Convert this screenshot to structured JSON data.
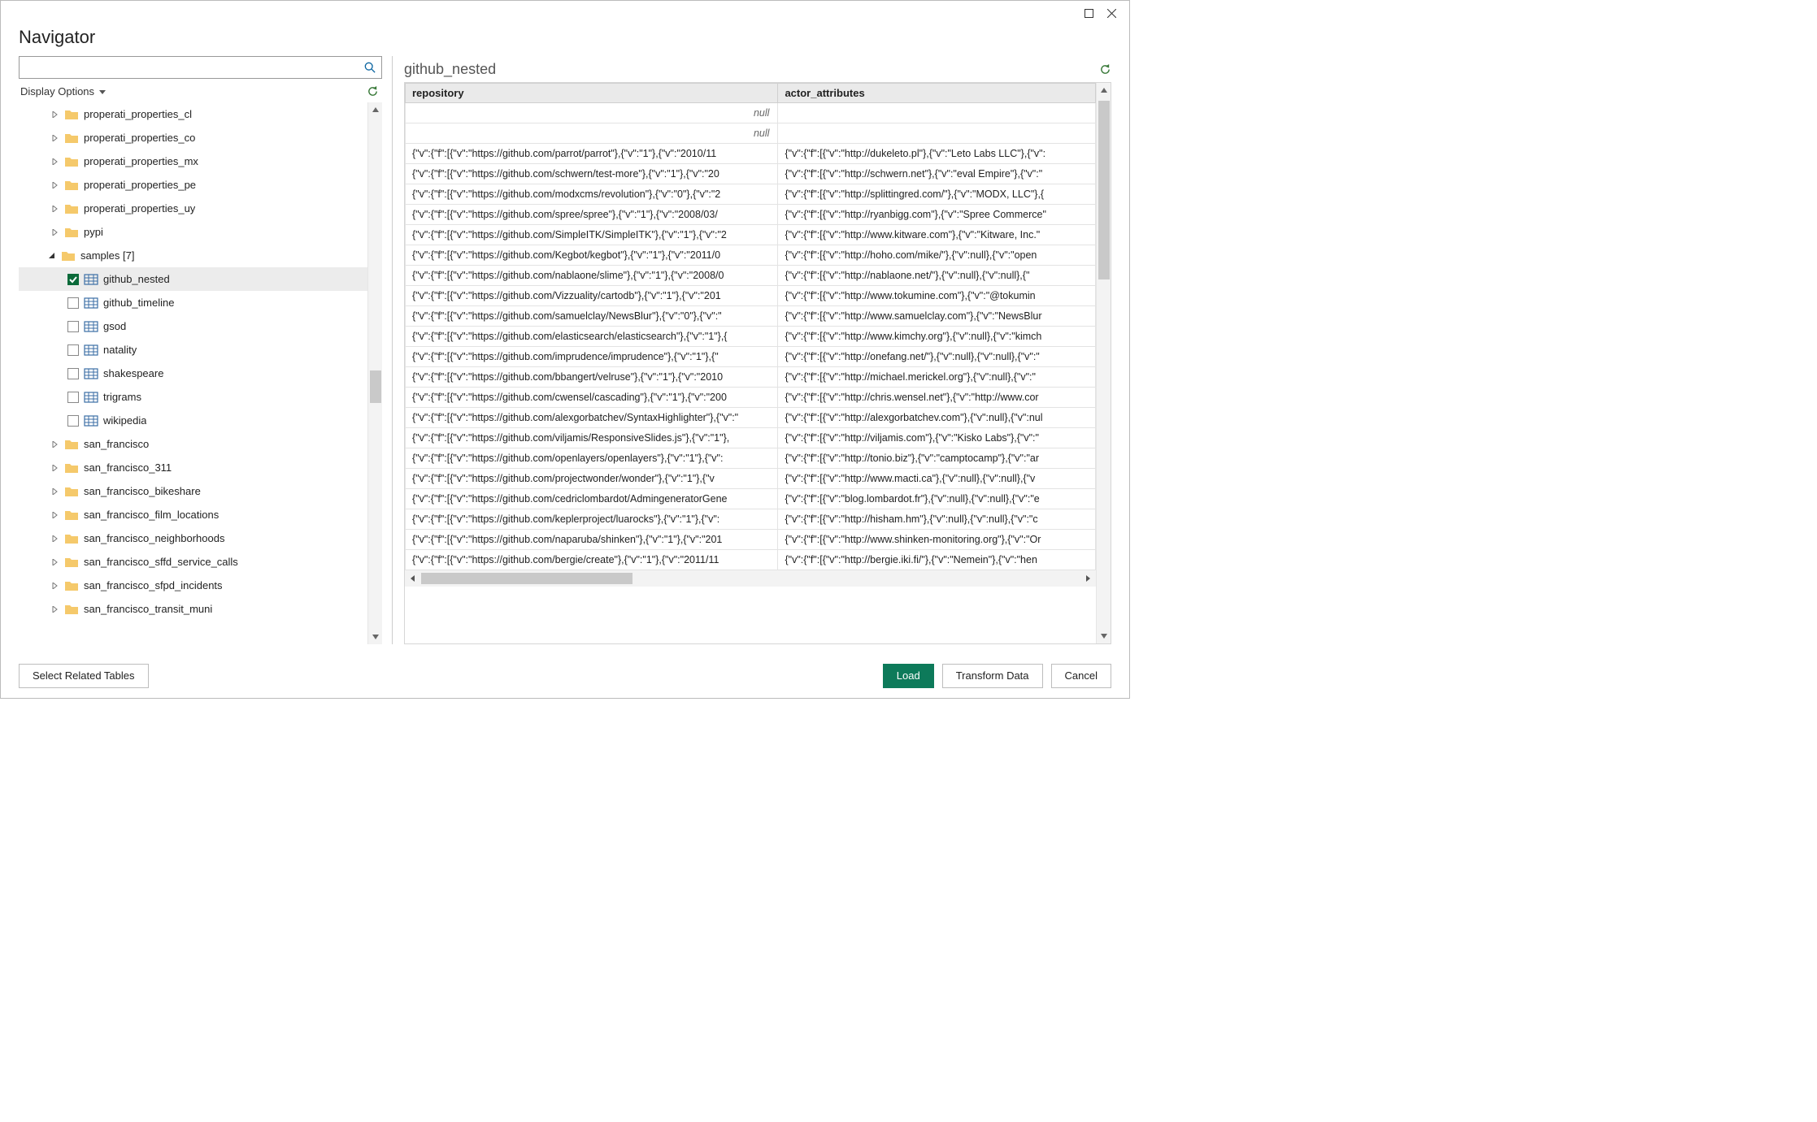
{
  "window_title": "Navigator",
  "search_placeholder": "",
  "display_options_label": "Display Options",
  "select_related_label": "Select Related Tables",
  "preview_title": "github_nested",
  "null_text": "null",
  "buttons": {
    "load": "Load",
    "transform": "Transform Data",
    "cancel": "Cancel"
  },
  "columns": [
    "repository",
    "actor_attributes"
  ],
  "tree_folders_top": [
    "properati_properties_cl",
    "properati_properties_co",
    "properati_properties_mx",
    "properati_properties_pe",
    "properati_properties_uy",
    "pypi"
  ],
  "samples_label": "samples [7]",
  "samples_children": [
    {
      "label": "github_nested",
      "checked": true
    },
    {
      "label": "github_timeline",
      "checked": false
    },
    {
      "label": "gsod",
      "checked": false
    },
    {
      "label": "natality",
      "checked": false
    },
    {
      "label": "shakespeare",
      "checked": false
    },
    {
      "label": "trigrams",
      "checked": false
    },
    {
      "label": "wikipedia",
      "checked": false
    }
  ],
  "tree_folders_bottom": [
    "san_francisco",
    "san_francisco_311",
    "san_francisco_bikeshare",
    "san_francisco_film_locations",
    "san_francisco_neighborhoods",
    "san_francisco_sffd_service_calls",
    "san_francisco_sfpd_incidents",
    "san_francisco_transit_muni"
  ],
  "rows": [
    {
      "repository": null,
      "actor_attributes": ""
    },
    {
      "repository": null,
      "actor_attributes": ""
    },
    {
      "repository": "{\"v\":{\"f\":[{\"v\":\"https://github.com/parrot/parrot\"},{\"v\":\"1\"},{\"v\":\"2010/11",
      "actor_attributes": "{\"v\":{\"f\":[{\"v\":\"http://dukeleto.pl\"},{\"v\":\"Leto Labs LLC\"},{\"v\":"
    },
    {
      "repository": "{\"v\":{\"f\":[{\"v\":\"https://github.com/schwern/test-more\"},{\"v\":\"1\"},{\"v\":\"20",
      "actor_attributes": "{\"v\":{\"f\":[{\"v\":\"http://schwern.net\"},{\"v\":\"eval Empire\"},{\"v\":\""
    },
    {
      "repository": "{\"v\":{\"f\":[{\"v\":\"https://github.com/modxcms/revolution\"},{\"v\":\"0\"},{\"v\":\"2",
      "actor_attributes": "{\"v\":{\"f\":[{\"v\":\"http://splittingred.com/\"},{\"v\":\"MODX, LLC\"},{"
    },
    {
      "repository": "{\"v\":{\"f\":[{\"v\":\"https://github.com/spree/spree\"},{\"v\":\"1\"},{\"v\":\"2008/03/",
      "actor_attributes": "{\"v\":{\"f\":[{\"v\":\"http://ryanbigg.com\"},{\"v\":\"Spree Commerce\""
    },
    {
      "repository": "{\"v\":{\"f\":[{\"v\":\"https://github.com/SimpleITK/SimpleITK\"},{\"v\":\"1\"},{\"v\":\"2",
      "actor_attributes": "{\"v\":{\"f\":[{\"v\":\"http://www.kitware.com\"},{\"v\":\"Kitware, Inc.\""
    },
    {
      "repository": "{\"v\":{\"f\":[{\"v\":\"https://github.com/Kegbot/kegbot\"},{\"v\":\"1\"},{\"v\":\"2011/0",
      "actor_attributes": "{\"v\":{\"f\":[{\"v\":\"http://hoho.com/mike/\"},{\"v\":null},{\"v\":\"open"
    },
    {
      "repository": "{\"v\":{\"f\":[{\"v\":\"https://github.com/nablaone/slime\"},{\"v\":\"1\"},{\"v\":\"2008/0",
      "actor_attributes": "{\"v\":{\"f\":[{\"v\":\"http://nablaone.net/\"},{\"v\":null},{\"v\":null},{\""
    },
    {
      "repository": "{\"v\":{\"f\":[{\"v\":\"https://github.com/Vizzuality/cartodb\"},{\"v\":\"1\"},{\"v\":\"201",
      "actor_attributes": "{\"v\":{\"f\":[{\"v\":\"http://www.tokumine.com\"},{\"v\":\"@tokumin"
    },
    {
      "repository": "{\"v\":{\"f\":[{\"v\":\"https://github.com/samuelclay/NewsBlur\"},{\"v\":\"0\"},{\"v\":\"",
      "actor_attributes": "{\"v\":{\"f\":[{\"v\":\"http://www.samuelclay.com\"},{\"v\":\"NewsBlur"
    },
    {
      "repository": "{\"v\":{\"f\":[{\"v\":\"https://github.com/elasticsearch/elasticsearch\"},{\"v\":\"1\"},{",
      "actor_attributes": "{\"v\":{\"f\":[{\"v\":\"http://www.kimchy.org\"},{\"v\":null},{\"v\":\"kimch"
    },
    {
      "repository": "{\"v\":{\"f\":[{\"v\":\"https://github.com/imprudence/imprudence\"},{\"v\":\"1\"},{\"",
      "actor_attributes": "{\"v\":{\"f\":[{\"v\":\"http://onefang.net/\"},{\"v\":null},{\"v\":null},{\"v\":\""
    },
    {
      "repository": "{\"v\":{\"f\":[{\"v\":\"https://github.com/bbangert/velruse\"},{\"v\":\"1\"},{\"v\":\"2010",
      "actor_attributes": "{\"v\":{\"f\":[{\"v\":\"http://michael.merickel.org\"},{\"v\":null},{\"v\":\""
    },
    {
      "repository": "{\"v\":{\"f\":[{\"v\":\"https://github.com/cwensel/cascading\"},{\"v\":\"1\"},{\"v\":\"200",
      "actor_attributes": "{\"v\":{\"f\":[{\"v\":\"http://chris.wensel.net\"},{\"v\":\"http://www.cor"
    },
    {
      "repository": "{\"v\":{\"f\":[{\"v\":\"https://github.com/alexgorbatchev/SyntaxHighlighter\"},{\"v\":\"",
      "actor_attributes": "{\"v\":{\"f\":[{\"v\":\"http://alexgorbatchev.com\"},{\"v\":null},{\"v\":nul"
    },
    {
      "repository": "{\"v\":{\"f\":[{\"v\":\"https://github.com/viljamis/ResponsiveSlides.js\"},{\"v\":\"1\"},",
      "actor_attributes": "{\"v\":{\"f\":[{\"v\":\"http://viljamis.com\"},{\"v\":\"Kisko Labs\"},{\"v\":\""
    },
    {
      "repository": "{\"v\":{\"f\":[{\"v\":\"https://github.com/openlayers/openlayers\"},{\"v\":\"1\"},{\"v\":",
      "actor_attributes": "{\"v\":{\"f\":[{\"v\":\"http://tonio.biz\"},{\"v\":\"camptocamp\"},{\"v\":\"ar"
    },
    {
      "repository": "{\"v\":{\"f\":[{\"v\":\"https://github.com/projectwonder/wonder\"},{\"v\":\"1\"},{\"v",
      "actor_attributes": "{\"v\":{\"f\":[{\"v\":\"http://www.macti.ca\"},{\"v\":null},{\"v\":null},{\"v"
    },
    {
      "repository": "{\"v\":{\"f\":[{\"v\":\"https://github.com/cedriclombardot/AdmingeneratorGene",
      "actor_attributes": "{\"v\":{\"f\":[{\"v\":\"blog.lombardot.fr\"},{\"v\":null},{\"v\":null},{\"v\":\"e"
    },
    {
      "repository": "{\"v\":{\"f\":[{\"v\":\"https://github.com/keplerproject/luarocks\"},{\"v\":\"1\"},{\"v\":",
      "actor_attributes": "{\"v\":{\"f\":[{\"v\":\"http://hisham.hm\"},{\"v\":null},{\"v\":null},{\"v\":\"c"
    },
    {
      "repository": "{\"v\":{\"f\":[{\"v\":\"https://github.com/naparuba/shinken\"},{\"v\":\"1\"},{\"v\":\"201",
      "actor_attributes": "{\"v\":{\"f\":[{\"v\":\"http://www.shinken-monitoring.org\"},{\"v\":\"Or"
    },
    {
      "repository": "{\"v\":{\"f\":[{\"v\":\"https://github.com/bergie/create\"},{\"v\":\"1\"},{\"v\":\"2011/11",
      "actor_attributes": "{\"v\":{\"f\":[{\"v\":\"http://bergie.iki.fi/\"},{\"v\":\"Nemein\"},{\"v\":\"hen"
    }
  ]
}
